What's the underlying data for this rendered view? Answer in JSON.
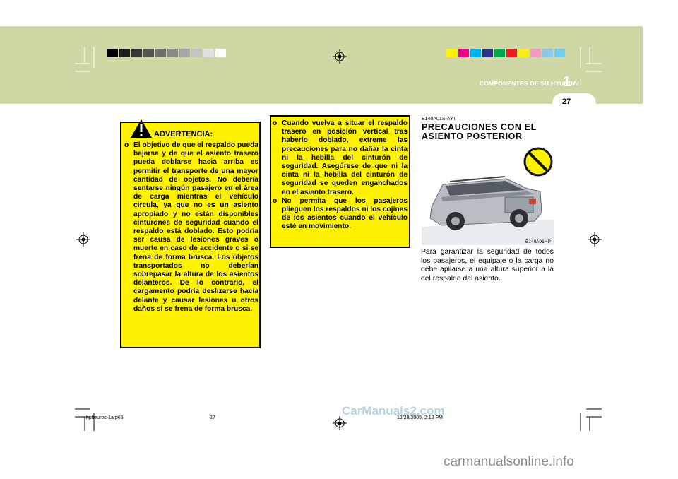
{
  "header": {
    "chapter_title": "COMPONENTES DE SU HYUNDAI",
    "chapter_number": "1",
    "page_number": "27"
  },
  "colors": {
    "band": "#cfd8a4",
    "warning_box": "#fff200",
    "gray_swatches": [
      "#000000",
      "#1c1c1c",
      "#383838",
      "#545454",
      "#6e6e6e",
      "#8a8a8a",
      "#a6a6a6",
      "#c4c4c4",
      "#e2e2e2",
      "#ffffff"
    ],
    "color_swatches": [
      "#fff200",
      "#ec008c",
      "#00aeef",
      "#2e3192",
      "#00a651",
      "#ed1c24",
      "#f7ec13",
      "#f49ac1",
      "#8dc8e8",
      "#6dcff6"
    ]
  },
  "warning": {
    "title": "ADVERTENCIA:",
    "marker": "o",
    "text": "El objetivo de que el respaldo pueda bajarse y de que el asiento trasero pueda doblarse hacia arriba es permitir el transporte de una mayor cantidad de objetos. No debería sentarse ningún pasajero en el área de carga mientras el vehículo circula, ya que no es un asiento apropiado y no están disponibles cinturones de seguridad cuando el respaldo está doblado. Esto podría ser causa de lesiones graves o muerte en caso de accidente o si se frena de forma brusca. Los objetos transportados no deberían sobrepasar la altura de los asientos delanteros. De lo contrario, el cargamento podría deslizarse hacia delante y causar lesiones u otros daños si se frena de forma brusca."
  },
  "cautions": [
    {
      "marker": "o",
      "text": "Cuando vuelva a situar el respaldo trasero en posición vertical tras haberlo doblado, extreme las precauciones para no dañar la cinta ni la hebilla del cinturón de seguridad. Asegúrese de que ni la cinta ni la hebilla del cinturón de seguridad se queden enganchados en el asiento trasero."
    },
    {
      "marker": "o",
      "text": "No permita que los pasajeros plieguen los respaldos ni los cojines de los asientos cuando el vehículo esté en movimiento."
    }
  ],
  "section": {
    "code": "B140A01S-AYT",
    "title": "PRECAUCIONES CON EL ASIENTO POSTERIOR",
    "image_label": "B140A01HP",
    "paragraph": "Para garantizar la seguridad de todos los pasajeros, el equipaje o la carga no debe apilarse a una altura superior a la del respaldo del asiento."
  },
  "footer": {
    "file": "hpfleuros-1a.p65",
    "page": "27",
    "timestamp": "12/28/2005, 2:12 PM",
    "watermark": "CarManuals2.com",
    "site": "carmanualsonline.info"
  }
}
